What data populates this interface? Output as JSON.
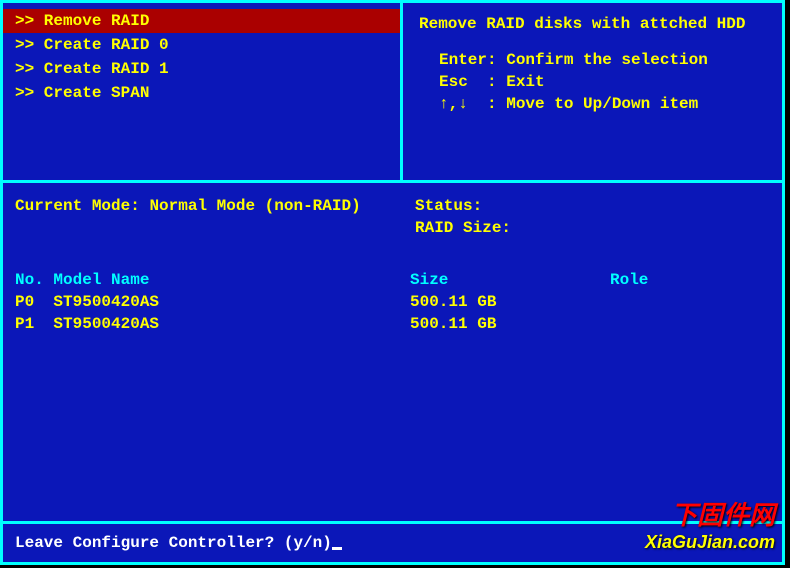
{
  "menu": {
    "items": [
      {
        "label": ">> Remove RAID",
        "selected": true
      },
      {
        "label": ">> Create RAID 0",
        "selected": false
      },
      {
        "label": ">> Create RAID 1",
        "selected": false
      },
      {
        "label": ">> Create SPAN",
        "selected": false
      }
    ]
  },
  "help": {
    "title": "Remove RAID disks with attched HDD",
    "lines": [
      "Enter: Confirm the selection",
      "Esc  : Exit",
      "↑,↓  : Move to Up/Down item"
    ]
  },
  "mode": {
    "label": "Current Mode:",
    "value": "Normal Mode (non-RAID)"
  },
  "status": {
    "label": "Status:",
    "raid_size_label": "RAID Size:"
  },
  "table": {
    "headers": {
      "no_model": "No. Model Name",
      "size": "Size",
      "role": "Role"
    },
    "rows": [
      {
        "no": "P0",
        "model": "ST9500420AS",
        "size": "500.11 GB",
        "role": ""
      },
      {
        "no": "P1",
        "model": "ST9500420AS",
        "size": "500.11 GB",
        "role": ""
      }
    ]
  },
  "prompt": {
    "text": "Leave Configure Controller? (y/n)"
  },
  "watermark": {
    "line1": "下固件网",
    "line2": "XiaGuJian.com"
  }
}
